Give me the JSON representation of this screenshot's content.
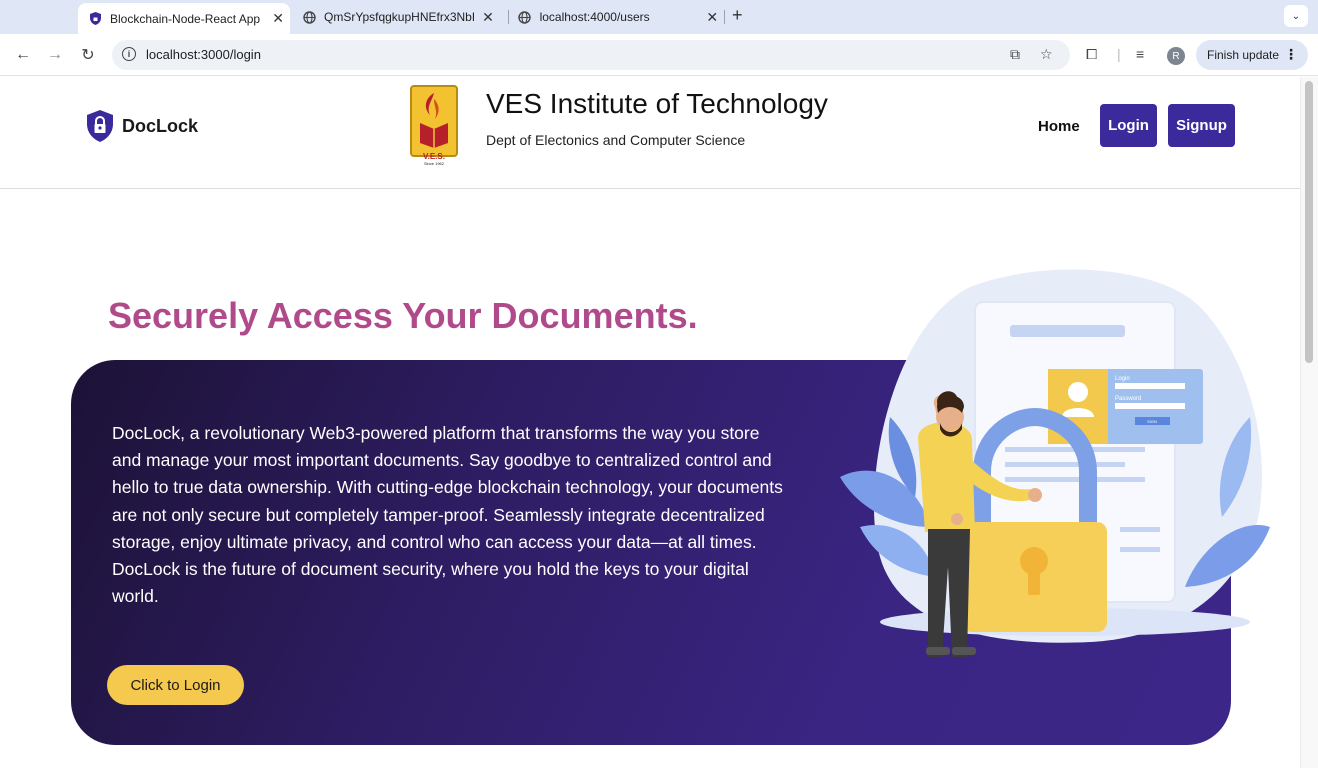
{
  "browser": {
    "tabs": [
      {
        "title": "Blockchain-Node-React App",
        "active": true
      },
      {
        "title": "QmSrYpsfqgkupHNEfrx3NbH",
        "active": false
      },
      {
        "title": "localhost:4000/users",
        "active": false
      }
    ],
    "url": "localhost:3000/login",
    "avatar_initial": "R",
    "finish_update_label": "Finish update"
  },
  "navbar": {
    "brand_name": "DocLock",
    "institute_name": "VES Institute of Technology",
    "department": "Dept of Electonics and Computer Science",
    "logo_text": "V.E.S.",
    "logo_since": "Since 1962",
    "home_label": "Home",
    "login_label": "Login",
    "signup_label": "Signup"
  },
  "hero": {
    "headline": "Securely Access Your Documents.",
    "description": "DocLock, a revolutionary Web3-powered platform that transforms the way you store and manage your most important documents. Say goodbye to centralized control and hello to true data ownership. With cutting-edge blockchain technology, your documents are not only secure but completely tamper-proof. Seamlessly integrate decentralized storage, enjoy ultimate privacy, and control who can access your data—at all times. DocLock is the future of document security, where you hold the keys to your digital world.",
    "cta_label": "Click to Login"
  },
  "illustration": {
    "form_login": "Login",
    "form_password": "Password",
    "form_button": "SIGN"
  },
  "colors": {
    "accent": "#3a2a9c",
    "headline": "#b14a8a",
    "cta": "#f4c94e"
  }
}
